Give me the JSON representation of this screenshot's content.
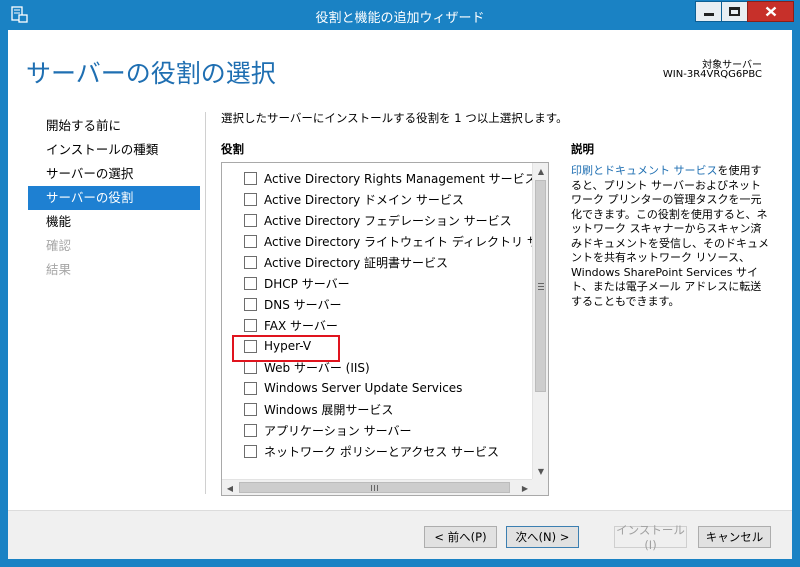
{
  "window": {
    "title": "役割と機能の追加ウィザード"
  },
  "header": {
    "title": "サーバーの役割の選択",
    "target_label": "対象サーバー",
    "target_name": "WIN-3R4VRQG6PBC"
  },
  "nav": {
    "items": [
      {
        "label": "開始する前に",
        "state": "normal"
      },
      {
        "label": "インストールの種類",
        "state": "normal"
      },
      {
        "label": "サーバーの選択",
        "state": "normal"
      },
      {
        "label": "サーバーの役割",
        "state": "active"
      },
      {
        "label": "機能",
        "state": "normal"
      },
      {
        "label": "確認",
        "state": "disabled"
      },
      {
        "label": "結果",
        "state": "disabled"
      }
    ]
  },
  "main": {
    "instruction": "選択したサーバーにインストールする役割を 1 つ以上選択します。",
    "roles_header": "役割",
    "roles": [
      {
        "label": "Active Directory Rights Management サービス",
        "checked": false
      },
      {
        "label": "Active Directory ドメイン サービス",
        "checked": false
      },
      {
        "label": "Active Directory フェデレーション サービス",
        "checked": false
      },
      {
        "label": "Active Directory ライトウェイト ディレクトリ サービス",
        "checked": false
      },
      {
        "label": "Active Directory 証明書サービス",
        "checked": false
      },
      {
        "label": "DHCP サーバー",
        "checked": false
      },
      {
        "label": "DNS サーバー",
        "checked": false
      },
      {
        "label": "FAX サーバー",
        "checked": false
      },
      {
        "label": "Hyper-V",
        "checked": false,
        "highlighted": true
      },
      {
        "label": "Web サーバー (IIS)",
        "checked": false
      },
      {
        "label": "Windows Server Update Services",
        "checked": false
      },
      {
        "label": "Windows 展開サービス",
        "checked": false
      },
      {
        "label": "アプリケーション サーバー",
        "checked": false
      },
      {
        "label": "ネットワーク ポリシーとアクセス サービス",
        "checked": false
      }
    ]
  },
  "description": {
    "header": "説明",
    "link_text": "印刷とドキュメント サービス",
    "text": "を使用すると、プリント サーバーおよびネットワーク プリンターの管理タスクを一元化できます。この役割を使用すると、ネットワーク スキャナーからスキャン済みドキュメントを受信し、そのドキュメントを共有ネットワーク リソース、Windows SharePoint Services サイト、または電子メール アドレスに転送することもできます。"
  },
  "footer": {
    "prev_label": "< 前へ(P)",
    "next_label": "次へ(N) >",
    "install_label": "インストール(I)",
    "cancel_label": "キャンセル"
  },
  "colors": {
    "chrome": "#1a82c4",
    "accent": "#1f6fb2",
    "active_nav": "#1e80d2",
    "highlight_box": "#e0141e"
  }
}
